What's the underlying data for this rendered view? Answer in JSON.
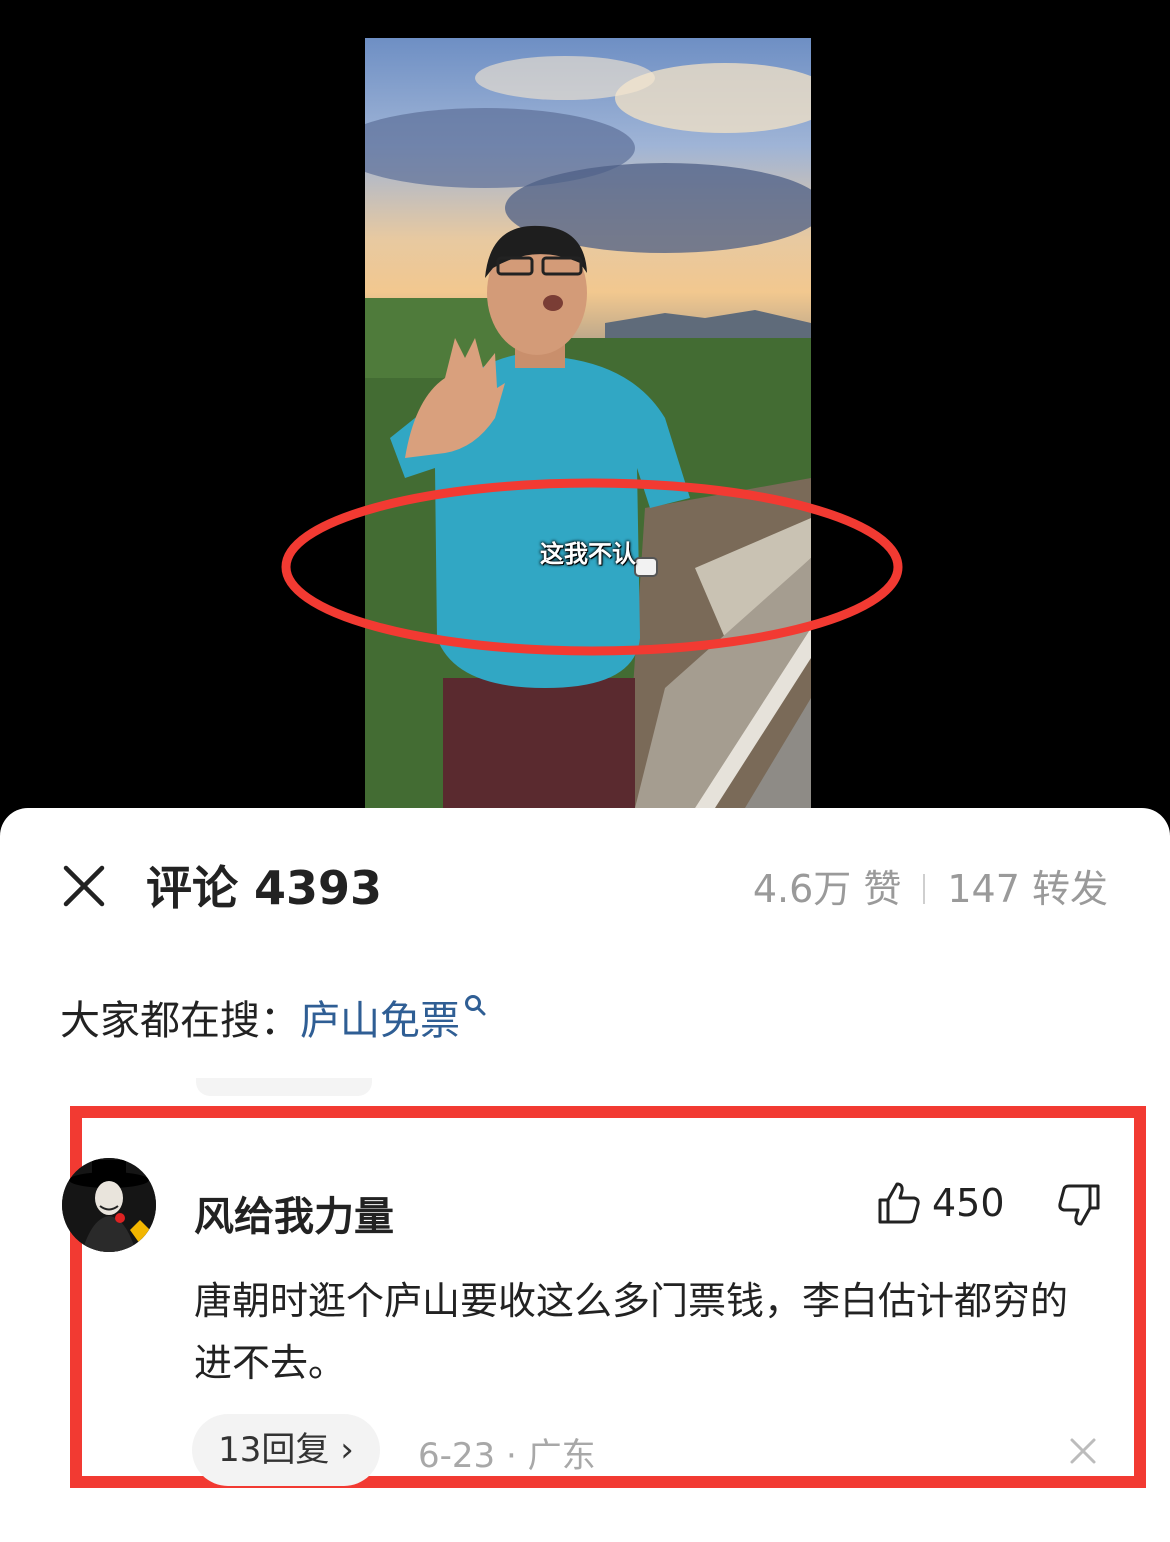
{
  "video": {
    "subtitle": "这我不认",
    "annotation_color": "#f23a32"
  },
  "comments_panel": {
    "title": "评论 4393",
    "likes": "4.6万 赞",
    "shares": "147 转发",
    "trending_label": "大家都在搜：",
    "trending_term": "庐山免票"
  },
  "comment": {
    "username": "风给我力量",
    "like_count": "450",
    "text": "唐朝时逛个庐山要收这么多门票钱，李白估计都穷的进不去。",
    "reply_label": "13回复 ›",
    "meta": "6-23 · 广东"
  },
  "icons": {
    "close": "close-icon",
    "search": "search-icon",
    "like": "thumbs-up-icon",
    "dislike": "thumbs-down-icon",
    "dismiss": "dismiss-icon"
  },
  "colors": {
    "highlight": "#f23a32",
    "link": "#2f5e94",
    "muted": "#9a9a9a"
  }
}
